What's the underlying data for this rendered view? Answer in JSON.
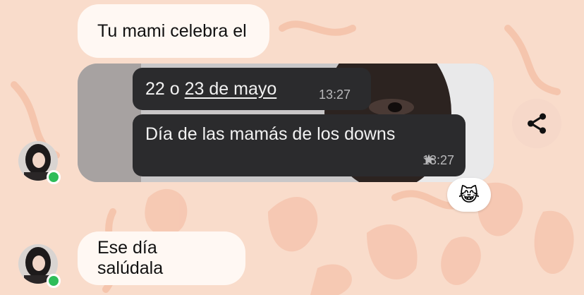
{
  "messages": {
    "first": "Tu mami celebra el",
    "last": "Ese día salúdala"
  },
  "media": {
    "date_line": {
      "text_before": "22 o ",
      "link": "23 de mayo",
      "time": "13:27"
    },
    "caption": {
      "text": "Día de las mamás de los downs",
      "time": "13:27",
      "starred": true
    }
  },
  "reaction": {
    "emoji": "😹",
    "icon": "cat-tears-of-joy-icon"
  },
  "icons": {
    "share": "share-icon",
    "star": "star-icon"
  },
  "colors": {
    "background": "#f9dccb",
    "bubble": "#fff8f3",
    "dark_bubble": "#2b2b2d",
    "online": "#2ebd59"
  }
}
